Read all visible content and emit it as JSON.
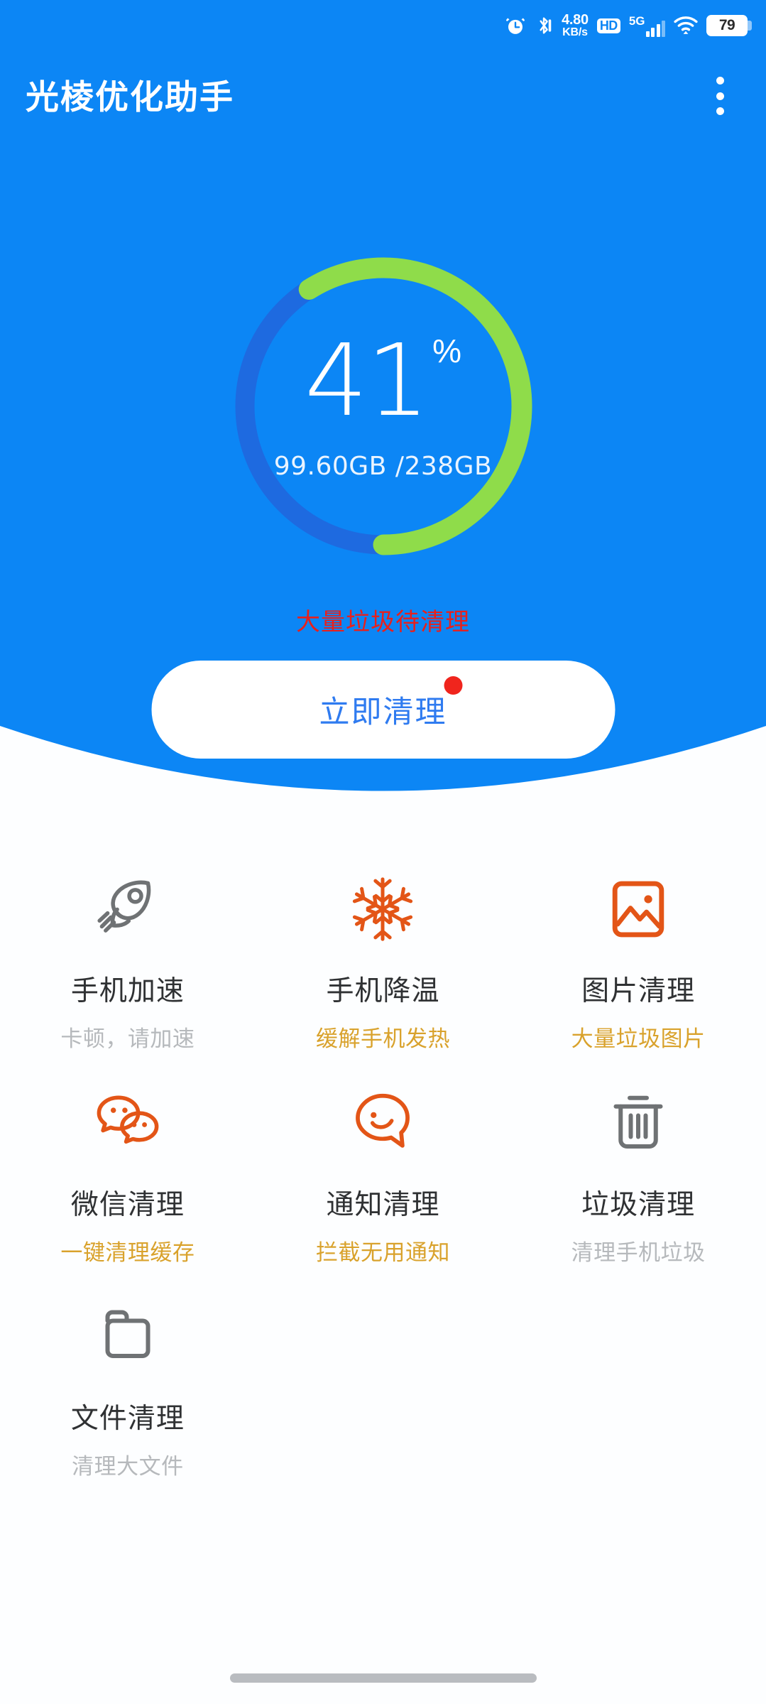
{
  "colors": {
    "header_blue": "#0c86f5",
    "track_blue": "#1e6ae0",
    "arc_green": "#8fdc4a",
    "accent_orange": "#e35517",
    "accent_amber": "#d9a22c",
    "alert_red": "#e8201c",
    "button_text_blue": "#2f7bf0",
    "icon_gray": "#6f7274",
    "subtitle_gray": "#b6b9bc"
  },
  "status_bar": {
    "alarm_icon": "alarm-clock-icon",
    "bluetooth_icon": "bluetooth-icon",
    "network_speed_value": "4.80",
    "network_speed_unit": "KB/s",
    "hd_label": "HD",
    "network_type": "5G",
    "signal_icon": "signal-bars-icon",
    "wifi_icon": "wifi-icon",
    "battery_level": "79"
  },
  "app_bar": {
    "title": "光棱优化助手",
    "menu_icon": "overflow-menu-icon"
  },
  "gauge": {
    "percent_value": "41",
    "percent_symbol": "%",
    "used_total_label": "99.60GB  /238GB",
    "used": "99.60GB",
    "total": "238GB",
    "percent_number": 41
  },
  "status_message": "大量垃圾待清理",
  "clean_button": {
    "label": "立即清理",
    "badge": "new-notification-dot"
  },
  "features": [
    {
      "id": "phone-boost",
      "icon": "rocket-icon",
      "icon_color": "#6f7274",
      "title": "手机加速",
      "subtitle": "卡顿，请加速",
      "subtitle_style": "sub-gray"
    },
    {
      "id": "phone-cooldown",
      "icon": "snowflake-icon",
      "icon_color": "#e35517",
      "title": "手机降温",
      "subtitle": "缓解手机发热",
      "subtitle_style": "sub-amber"
    },
    {
      "id": "photo-cleanup",
      "icon": "image-icon",
      "icon_color": "#e35517",
      "title": "图片清理",
      "subtitle": "大量垃圾图片",
      "subtitle_style": "sub-amber"
    },
    {
      "id": "wechat-cleanup",
      "icon": "wechat-icon",
      "icon_color": "#e35517",
      "title": "微信清理",
      "subtitle": "一键清理缓存",
      "subtitle_style": "sub-amber"
    },
    {
      "id": "notification-clean",
      "icon": "chat-smile-icon",
      "icon_color": "#e35517",
      "title": "通知清理",
      "subtitle": "拦截无用通知",
      "subtitle_style": "sub-amber"
    },
    {
      "id": "junk-cleanup",
      "icon": "trash-icon",
      "icon_color": "#6f7274",
      "title": "垃圾清理",
      "subtitle": "清理手机垃圾",
      "subtitle_style": "sub-gray"
    },
    {
      "id": "file-cleanup",
      "icon": "folder-icon",
      "icon_color": "#6f7274",
      "title": "文件清理",
      "subtitle": "清理大文件",
      "subtitle_style": "sub-gray"
    }
  ],
  "home_indicator": "home-gesture-bar"
}
